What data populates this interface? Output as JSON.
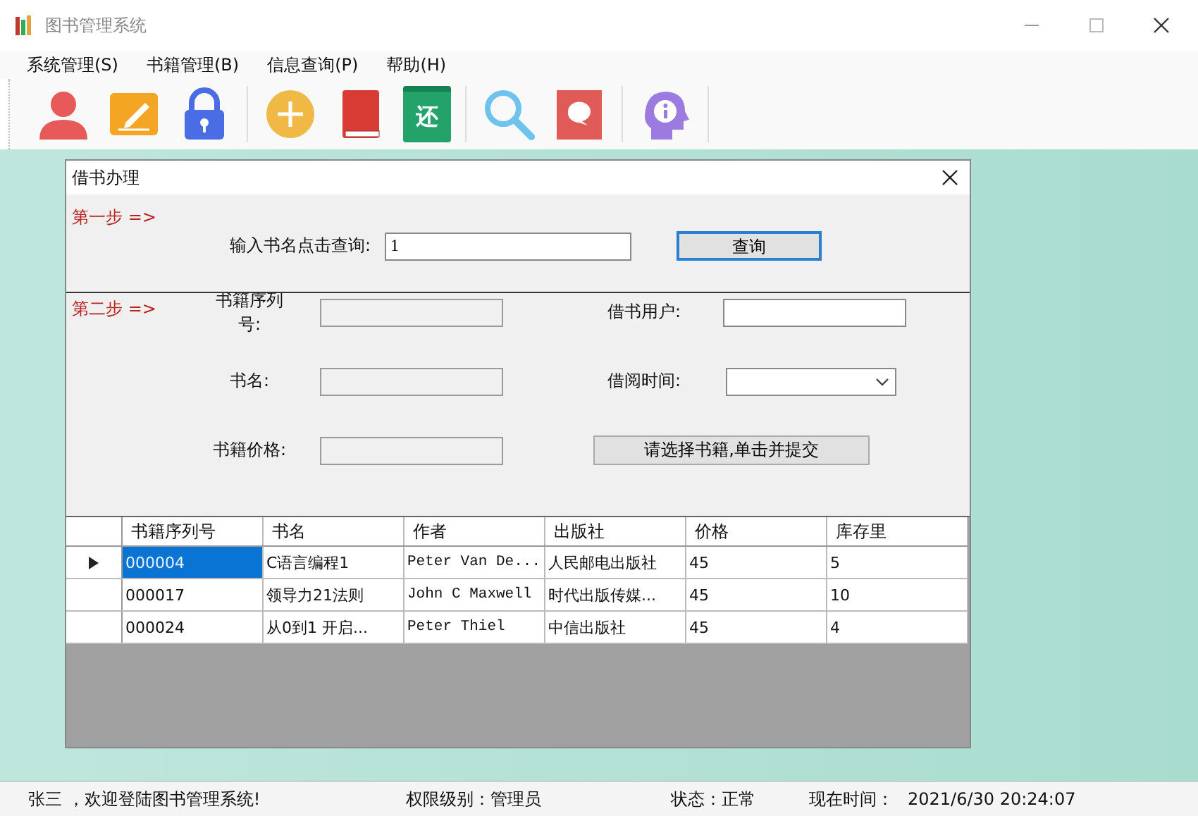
{
  "window": {
    "title": "图书管理系统"
  },
  "menu": [
    {
      "label": "系统管理(S)"
    },
    {
      "label": "书籍管理(B)"
    },
    {
      "label": "信息查询(P)"
    },
    {
      "label": "帮助(H)"
    }
  ],
  "toolbar": {
    "return_icon_text": "还"
  },
  "dialog": {
    "title": "借书办理",
    "step1": {
      "label": "第一步 =>",
      "query_label": "输入书名点击查询:",
      "query_value": "1",
      "query_button": "查询"
    },
    "step2": {
      "label": "第二步 =>",
      "left_fields": [
        {
          "label": "书籍序列号:",
          "kind": "text",
          "disabled": true
        },
        {
          "label": "书名:",
          "kind": "text",
          "disabled": true
        },
        {
          "label": "书籍价格:",
          "kind": "text",
          "disabled": true
        }
      ],
      "right_fields": [
        {
          "label": "借书用户:",
          "kind": "text",
          "disabled": false
        },
        {
          "label": "借阅时间:",
          "kind": "dropdown",
          "disabled": false
        }
      ],
      "submit_button": "请选择书籍,单击并提交"
    },
    "table": {
      "columns": [
        "书籍序列号",
        "书名",
        "作者",
        "出版社",
        "价格",
        "库存里"
      ],
      "rows": [
        {
          "selected": true,
          "cells": [
            "000004",
            "C语言编程1",
            "Peter Van De...",
            "人民邮电出版社",
            "45",
            "5"
          ]
        },
        {
          "selected": false,
          "cells": [
            "000017",
            "领导力21法则",
            "John C Maxwell",
            "时代出版传媒...",
            "45",
            "10"
          ]
        },
        {
          "selected": false,
          "cells": [
            "000024",
            "从0到1 开启...",
            "Peter Thiel",
            "中信出版社",
            "45",
            "4"
          ]
        }
      ]
    }
  },
  "status_bar": [
    "张三 ，欢迎登陆图书管理系统!",
    "权限级别：管理员",
    "状态：正常",
    "现在时间：",
    "2021/6/30 20:24:07"
  ]
}
